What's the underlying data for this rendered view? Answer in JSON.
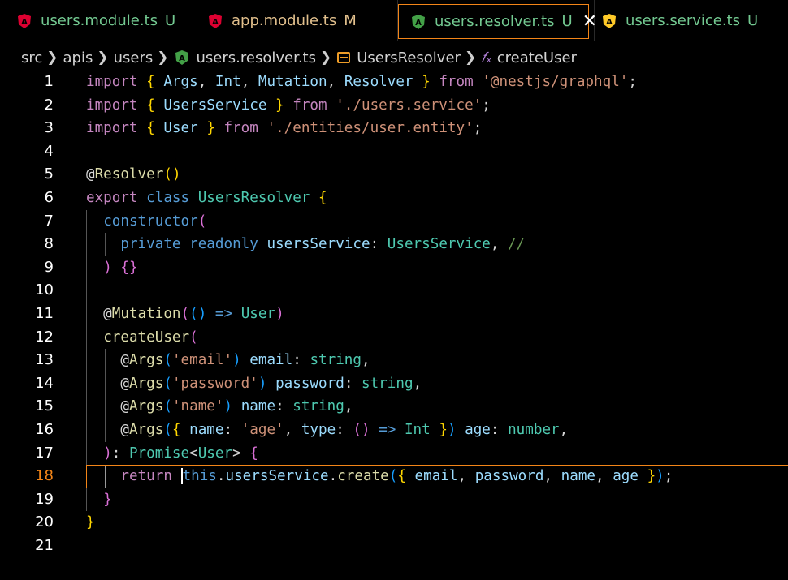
{
  "tabs": [
    {
      "label": "users.module.ts",
      "badge": "U",
      "icon": "angular-icon",
      "icon_color": "#dd0031",
      "label_color": "#73c991",
      "badge_color": "#73c991",
      "active": false
    },
    {
      "label": "app.module.ts",
      "badge": "M",
      "icon": "angular-icon",
      "icon_color": "#dd0031",
      "label_color": "#e2c08d",
      "badge_color": "#e2c08d",
      "active": false
    },
    {
      "label": "users.resolver.ts",
      "badge": "U",
      "icon": "angular-resolver-icon",
      "icon_color": "#43a047",
      "label_color": "#73c991",
      "badge_color": "#73c991",
      "active": true
    },
    {
      "label": "users.service.ts",
      "badge": "U",
      "icon": "angular-service-icon",
      "icon_color": "#ffca28",
      "label_color": "#73c991",
      "badge_color": "#73c991",
      "active": false
    }
  ],
  "breadcrumb": {
    "folders": [
      "src",
      "apis",
      "users"
    ],
    "file": "users.resolver.ts",
    "class_name": "UsersResolver",
    "method": "createUser"
  },
  "editor": {
    "current_line": 18,
    "line_numbers": [
      "1",
      "2",
      "3",
      "4",
      "5",
      "6",
      "7",
      "8",
      "9",
      "10",
      "11",
      "12",
      "13",
      "14",
      "15",
      "16",
      "17",
      "18",
      "19",
      "20",
      "21"
    ]
  },
  "colors": {
    "accent": "#f38518",
    "keyword_control": "#c586c0",
    "keyword_storage": "#569cd6",
    "type": "#4ec9b0",
    "function": "#dcdcaa",
    "string": "#ce9178",
    "variable": "#9cdcfe",
    "bracket_1": "#ffd700",
    "bracket_2": "#da70d6",
    "bracket_3": "#179fff"
  },
  "code_lines": [
    [
      [
        "kw",
        "import"
      ],
      [
        "pn",
        " "
      ],
      [
        "b1",
        "{"
      ],
      [
        "pn",
        " "
      ],
      [
        "vr",
        "Args"
      ],
      [
        "pn",
        ", "
      ],
      [
        "vr",
        "Int"
      ],
      [
        "pn",
        ", "
      ],
      [
        "vr",
        "Mutation"
      ],
      [
        "pn",
        ", "
      ],
      [
        "vr",
        "Resolver"
      ],
      [
        "pn",
        " "
      ],
      [
        "b1",
        "}"
      ],
      [
        "pn",
        " "
      ],
      [
        "kw",
        "from"
      ],
      [
        "pn",
        " "
      ],
      [
        "st",
        "'@nestjs/graphql'"
      ],
      [
        "pn",
        ";"
      ]
    ],
    [
      [
        "kw",
        "import"
      ],
      [
        "pn",
        " "
      ],
      [
        "b1",
        "{"
      ],
      [
        "pn",
        " "
      ],
      [
        "vr",
        "UsersService"
      ],
      [
        "pn",
        " "
      ],
      [
        "b1",
        "}"
      ],
      [
        "pn",
        " "
      ],
      [
        "kw",
        "from"
      ],
      [
        "pn",
        " "
      ],
      [
        "st",
        "'./users.service'"
      ],
      [
        "pn",
        ";"
      ]
    ],
    [
      [
        "kw",
        "import"
      ],
      [
        "pn",
        " "
      ],
      [
        "b1",
        "{"
      ],
      [
        "pn",
        " "
      ],
      [
        "vr",
        "User"
      ],
      [
        "pn",
        " "
      ],
      [
        "b1",
        "}"
      ],
      [
        "pn",
        " "
      ],
      [
        "kw",
        "from"
      ],
      [
        "pn",
        " "
      ],
      [
        "st",
        "'./entities/user.entity'"
      ],
      [
        "pn",
        ";"
      ]
    ],
    [],
    [
      [
        "pn",
        "@"
      ],
      [
        "fn",
        "Resolver"
      ],
      [
        "b1",
        "("
      ],
      [
        "b1",
        ")"
      ]
    ],
    [
      [
        "kw",
        "export"
      ],
      [
        "pn",
        " "
      ],
      [
        "kb",
        "class"
      ],
      [
        "pn",
        " "
      ],
      [
        "ty",
        "UsersResolver"
      ],
      [
        "pn",
        " "
      ],
      [
        "b1",
        "{"
      ]
    ],
    [
      [
        "pn",
        "  "
      ],
      [
        "kb",
        "constructor"
      ],
      [
        "b2",
        "("
      ]
    ],
    [
      [
        "pn",
        "    "
      ],
      [
        "kb",
        "private"
      ],
      [
        "pn",
        " "
      ],
      [
        "kb",
        "readonly"
      ],
      [
        "pn",
        " "
      ],
      [
        "vr",
        "usersService"
      ],
      [
        "pn",
        ": "
      ],
      [
        "ty",
        "UsersService"
      ],
      [
        "pn",
        ", "
      ],
      [
        "cm",
        "//"
      ]
    ],
    [
      [
        "pn",
        "  "
      ],
      [
        "b2",
        ")"
      ],
      [
        "pn",
        " "
      ],
      [
        "b2",
        "{}"
      ]
    ],
    [],
    [
      [
        "pn",
        "  @"
      ],
      [
        "fn",
        "Mutation"
      ],
      [
        "b2",
        "("
      ],
      [
        "b3",
        "()"
      ],
      [
        "pn",
        " "
      ],
      [
        "kb",
        "=>"
      ],
      [
        "pn",
        " "
      ],
      [
        "ty",
        "User"
      ],
      [
        "b2",
        ")"
      ]
    ],
    [
      [
        "pn",
        "  "
      ],
      [
        "fn",
        "createUser"
      ],
      [
        "b2",
        "("
      ]
    ],
    [
      [
        "pn",
        "    @"
      ],
      [
        "fn",
        "Args"
      ],
      [
        "b3",
        "("
      ],
      [
        "st",
        "'email'"
      ],
      [
        "b3",
        ")"
      ],
      [
        "pn",
        " "
      ],
      [
        "vr",
        "email"
      ],
      [
        "pn",
        ": "
      ],
      [
        "ty",
        "string"
      ],
      [
        "pn",
        ","
      ]
    ],
    [
      [
        "pn",
        "    @"
      ],
      [
        "fn",
        "Args"
      ],
      [
        "b3",
        "("
      ],
      [
        "st",
        "'password'"
      ],
      [
        "b3",
        ")"
      ],
      [
        "pn",
        " "
      ],
      [
        "vr",
        "password"
      ],
      [
        "pn",
        ": "
      ],
      [
        "ty",
        "string"
      ],
      [
        "pn",
        ","
      ]
    ],
    [
      [
        "pn",
        "    @"
      ],
      [
        "fn",
        "Args"
      ],
      [
        "b3",
        "("
      ],
      [
        "st",
        "'name'"
      ],
      [
        "b3",
        ")"
      ],
      [
        "pn",
        " "
      ],
      [
        "vr",
        "name"
      ],
      [
        "pn",
        ": "
      ],
      [
        "ty",
        "string"
      ],
      [
        "pn",
        ","
      ]
    ],
    [
      [
        "pn",
        "    @"
      ],
      [
        "fn",
        "Args"
      ],
      [
        "b3",
        "("
      ],
      [
        "b1",
        "{"
      ],
      [
        "pn",
        " "
      ],
      [
        "vr",
        "name"
      ],
      [
        "pn",
        ": "
      ],
      [
        "st",
        "'age'"
      ],
      [
        "pn",
        ", "
      ],
      [
        "vr",
        "type"
      ],
      [
        "pn",
        ": "
      ],
      [
        "b2",
        "()"
      ],
      [
        "pn",
        " "
      ],
      [
        "kb",
        "=>"
      ],
      [
        "pn",
        " "
      ],
      [
        "ty",
        "Int"
      ],
      [
        "pn",
        " "
      ],
      [
        "b1",
        "}"
      ],
      [
        "b3",
        ")"
      ],
      [
        "pn",
        " "
      ],
      [
        "vr",
        "age"
      ],
      [
        "pn",
        ": "
      ],
      [
        "ty",
        "number"
      ],
      [
        "pn",
        ","
      ]
    ],
    [
      [
        "pn",
        "  "
      ],
      [
        "b2",
        ")"
      ],
      [
        "pn",
        ": "
      ],
      [
        "ty",
        "Promise"
      ],
      [
        "pn",
        "<"
      ],
      [
        "ty",
        "User"
      ],
      [
        "pn",
        "> "
      ],
      [
        "b2",
        "{"
      ]
    ],
    [
      [
        "pn",
        "    "
      ],
      [
        "kw",
        "return"
      ],
      [
        "pn",
        " "
      ],
      [
        "caret",
        ""
      ],
      [
        "kb",
        "this"
      ],
      [
        "pn",
        "."
      ],
      [
        "vr",
        "usersService"
      ],
      [
        "pn",
        "."
      ],
      [
        "fn",
        "create"
      ],
      [
        "b3",
        "("
      ],
      [
        "b1",
        "{"
      ],
      [
        "pn",
        " "
      ],
      [
        "vr",
        "email"
      ],
      [
        "pn",
        ", "
      ],
      [
        "vr",
        "password"
      ],
      [
        "pn",
        ", "
      ],
      [
        "vr",
        "name"
      ],
      [
        "pn",
        ", "
      ],
      [
        "vr",
        "age"
      ],
      [
        "pn",
        " "
      ],
      [
        "b1",
        "}"
      ],
      [
        "b3",
        ")"
      ],
      [
        "pn",
        ";"
      ]
    ],
    [
      [
        "pn",
        "  "
      ],
      [
        "b2",
        "}"
      ]
    ],
    [
      [
        "b1",
        "}"
      ]
    ],
    []
  ]
}
